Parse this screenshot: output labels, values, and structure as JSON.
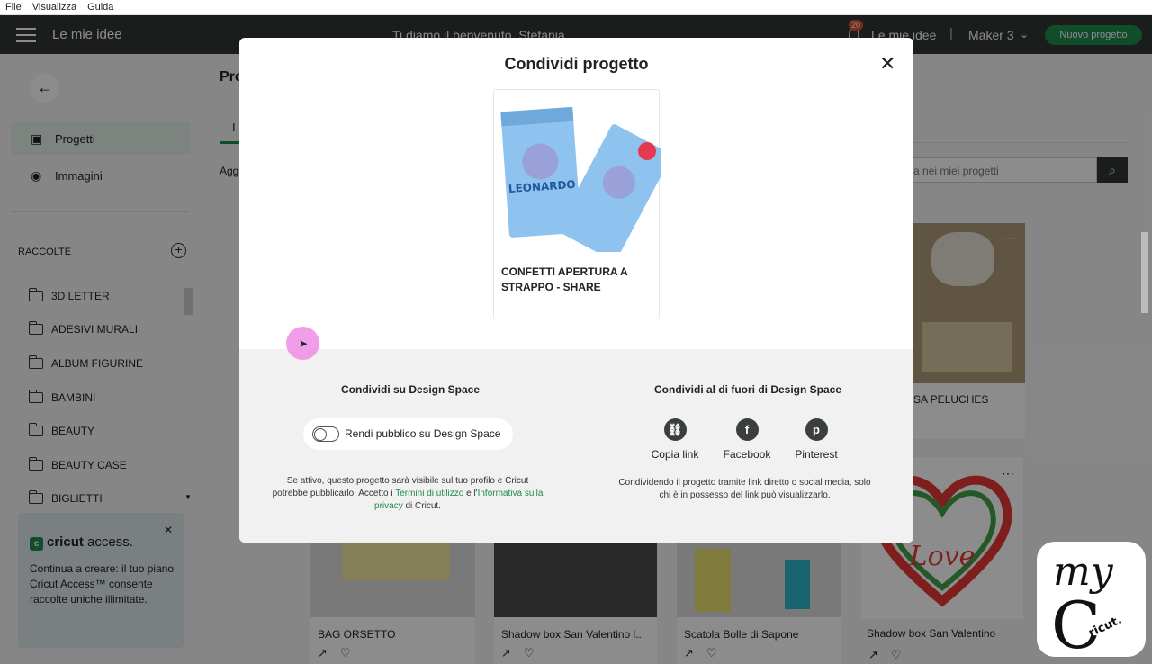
{
  "menubar": {
    "file": "File",
    "view": "Visualizza",
    "help": "Guida"
  },
  "topbar": {
    "title": "Le mie idee",
    "welcome": "Ti diamo il benvenuto, Stefania",
    "badge": "20",
    "ideas": "Le mie idee",
    "separator": "|",
    "machine": "Maker 3",
    "new_project": "Nuovo progetto"
  },
  "sidebar": {
    "projects": "Progetti",
    "images": "Immagini",
    "collections_header": "RACCOLTE",
    "folders": [
      "3D LETTER",
      "ADESIVI MURALI",
      "ALBUM FIGURINE",
      "BAMBINI",
      "BEAUTY",
      "BEAUTY CASE",
      "BIGLIETTI"
    ],
    "access": {
      "brand": "cricut",
      "brand_suffix": "access.",
      "text": "Continua a creare: il tuo piano Cricut Access™ consente raccolte uniche illimitate."
    }
  },
  "main": {
    "title": "Pro",
    "tab": "I",
    "agg": "Agg",
    "search_placeholder": "a nei miei progetti",
    "cards": [
      {
        "name": "BAG ORSETTO"
      },
      {
        "name": "Shadow box San Valentino l..."
      },
      {
        "name": "Scatola Bolle di Sapone"
      },
      {
        "name": "Shadow box San Valentino"
      }
    ],
    "teddy_label": "SA PELUCHES",
    "heart_text": "Love"
  },
  "modal": {
    "title": "Condividi progetto",
    "project_name": "CONFETTI APERTURA A STRAPPO - SHARE",
    "bag_text": "LEONARDO",
    "left": {
      "title": "Condividi su Design Space",
      "toggle_label": "Rendi pubblico su Design Space",
      "desc_1": "Se attivo, questo progetto sarà visibile sul tuo profilo e Cricut potrebbe pubblicarlo. Accetto i ",
      "link_terms": "Termini di utilizzo",
      "desc_2": " e l'",
      "link_privacy": "Informativa sulla privacy",
      "desc_3": " di Cricut."
    },
    "right": {
      "title": "Condividi al di fuori di Design Space",
      "copy_link": "Copia link",
      "facebook": "Facebook",
      "pinterest": "Pinterest",
      "desc": "Condividendo il progetto tramite link diretto o social media, solo chi è in possesso del link può visualizzarlo."
    }
  },
  "watermark": {
    "text_my": "my",
    "text_c": "C",
    "text_cricut": "ricut."
  },
  "colors": {
    "topbar": "#303633",
    "accent": "#1f8a4f",
    "modal_bottom": "#f1f1f1"
  }
}
